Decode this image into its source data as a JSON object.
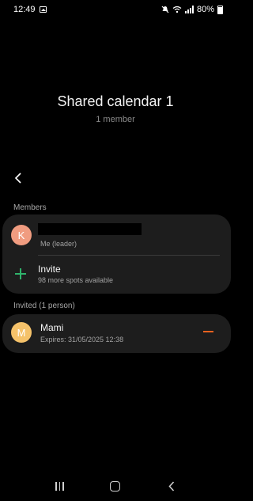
{
  "status_bar": {
    "time": "12:49",
    "battery": "80%"
  },
  "header": {
    "title": "Shared calendar 1",
    "subtitle": "1 member"
  },
  "members_section": {
    "label": "Members",
    "me": {
      "avatar_letter": "K",
      "avatar_color": "#f09c80",
      "role": "Me (leader)"
    },
    "invite": {
      "label": "Invite",
      "subtext": "98 more spots available",
      "icon": "plus-icon",
      "accent": "#2fb36b"
    }
  },
  "invited_section": {
    "label": "Invited (1 person)",
    "people": [
      {
        "avatar_letter": "M",
        "avatar_color": "#f5c26a",
        "name": "Mami",
        "expires": "Expires: 31/05/2025 12:38",
        "remove_color": "#e8611f"
      }
    ]
  }
}
